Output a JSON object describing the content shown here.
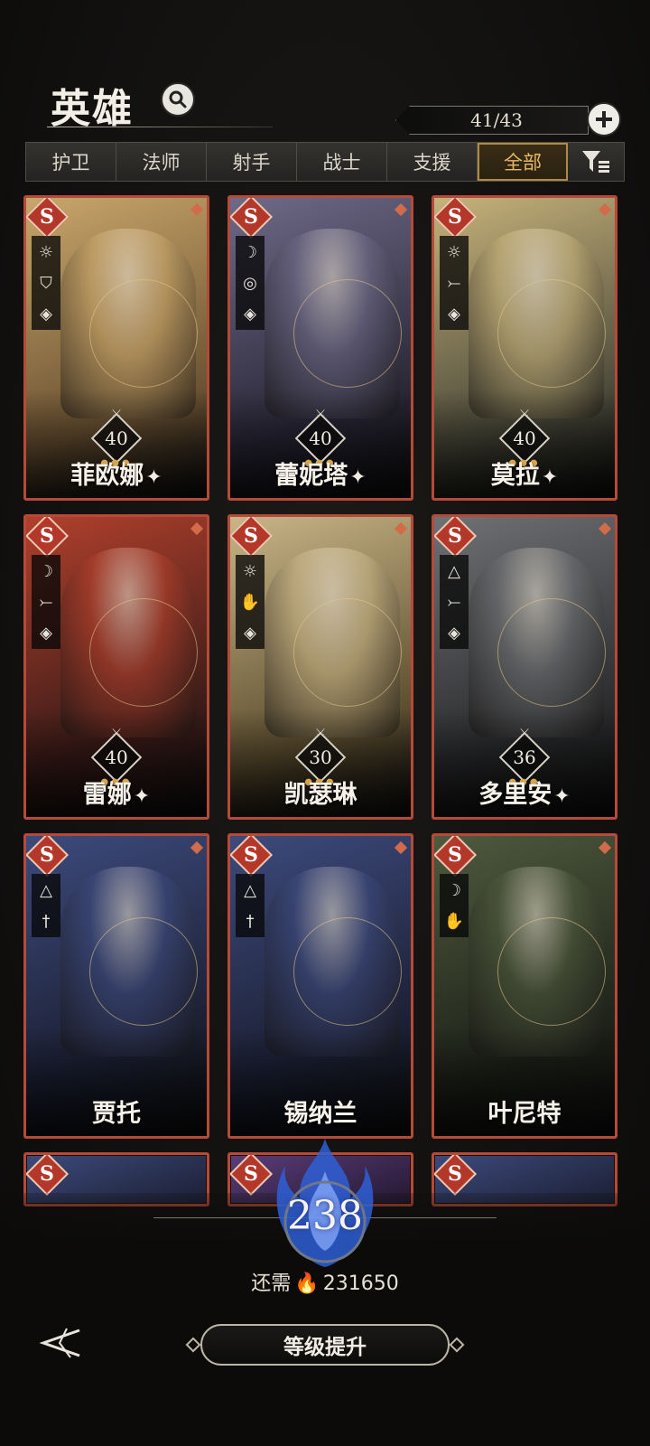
{
  "header": {
    "title": "英雄",
    "hero_count": "41/43"
  },
  "tabs": [
    "护卫",
    "法师",
    "射手",
    "战士",
    "支援",
    "全部"
  ],
  "active_tab": "全部",
  "heroes": [
    {
      "name": "菲欧娜",
      "rank": "S",
      "level": "40",
      "star": "✦",
      "roles": [
        "sun-icon",
        "shield-icon",
        "dragon-icon"
      ],
      "colors": [
        "#c9a66a",
        "#6b5232"
      ]
    },
    {
      "name": "蕾妮塔",
      "rank": "S",
      "level": "40",
      "star": "✦",
      "roles": [
        "moon-icon",
        "swirl-icon",
        "dragon-icon"
      ],
      "colors": [
        "#6e6a88",
        "#2a2738"
      ]
    },
    {
      "name": "莫拉",
      "rank": "S",
      "level": "40",
      "star": "✦",
      "roles": [
        "sun-icon",
        "bow-icon",
        "dragon-icon"
      ],
      "colors": [
        "#c7b27a",
        "#4b4a3a"
      ]
    },
    {
      "name": "雷娜",
      "rank": "S",
      "level": "40",
      "star": "✦",
      "roles": [
        "moon-icon",
        "bow-icon",
        "dragon-icon"
      ],
      "colors": [
        "#b1402c",
        "#3b1b18"
      ]
    },
    {
      "name": "凯瑟琳",
      "rank": "S",
      "level": "30",
      "star": "",
      "roles": [
        "sun-icon",
        "palm-icon",
        "dragon-icon"
      ],
      "colors": [
        "#c9b587",
        "#5d4e2f"
      ]
    },
    {
      "name": "多里安",
      "rank": "S",
      "level": "36",
      "star": "✦",
      "roles": [
        "triangle-icon",
        "bow-icon",
        "dragon-icon"
      ],
      "colors": [
        "#6f7174",
        "#2a2b2d"
      ]
    },
    {
      "name": "贾托",
      "rank": "S",
      "level": "",
      "star": "",
      "roles": [
        "triangle-icon",
        "dagger-icon"
      ],
      "colors": [
        "#3d4a7c",
        "#1b1f33"
      ]
    },
    {
      "name": "锡纳兰",
      "rank": "S",
      "level": "",
      "star": "",
      "roles": [
        "triangle-icon",
        "dagger-icon"
      ],
      "colors": [
        "#3d4a7c",
        "#1b1f33"
      ]
    },
    {
      "name": "叶尼特",
      "rank": "S",
      "level": "",
      "star": "",
      "roles": [
        "moon-icon",
        "palm-icon"
      ],
      "colors": [
        "#4f5a3e",
        "#1d2118"
      ]
    }
  ],
  "footer": {
    "total_level": "238",
    "cost_label": "还需",
    "cost_value": "231650",
    "upgrade_label": "等级提升"
  },
  "accent": {
    "card_border": "#b44a37",
    "active_tab": "#e8b866",
    "flame": "#3f6fe0"
  }
}
